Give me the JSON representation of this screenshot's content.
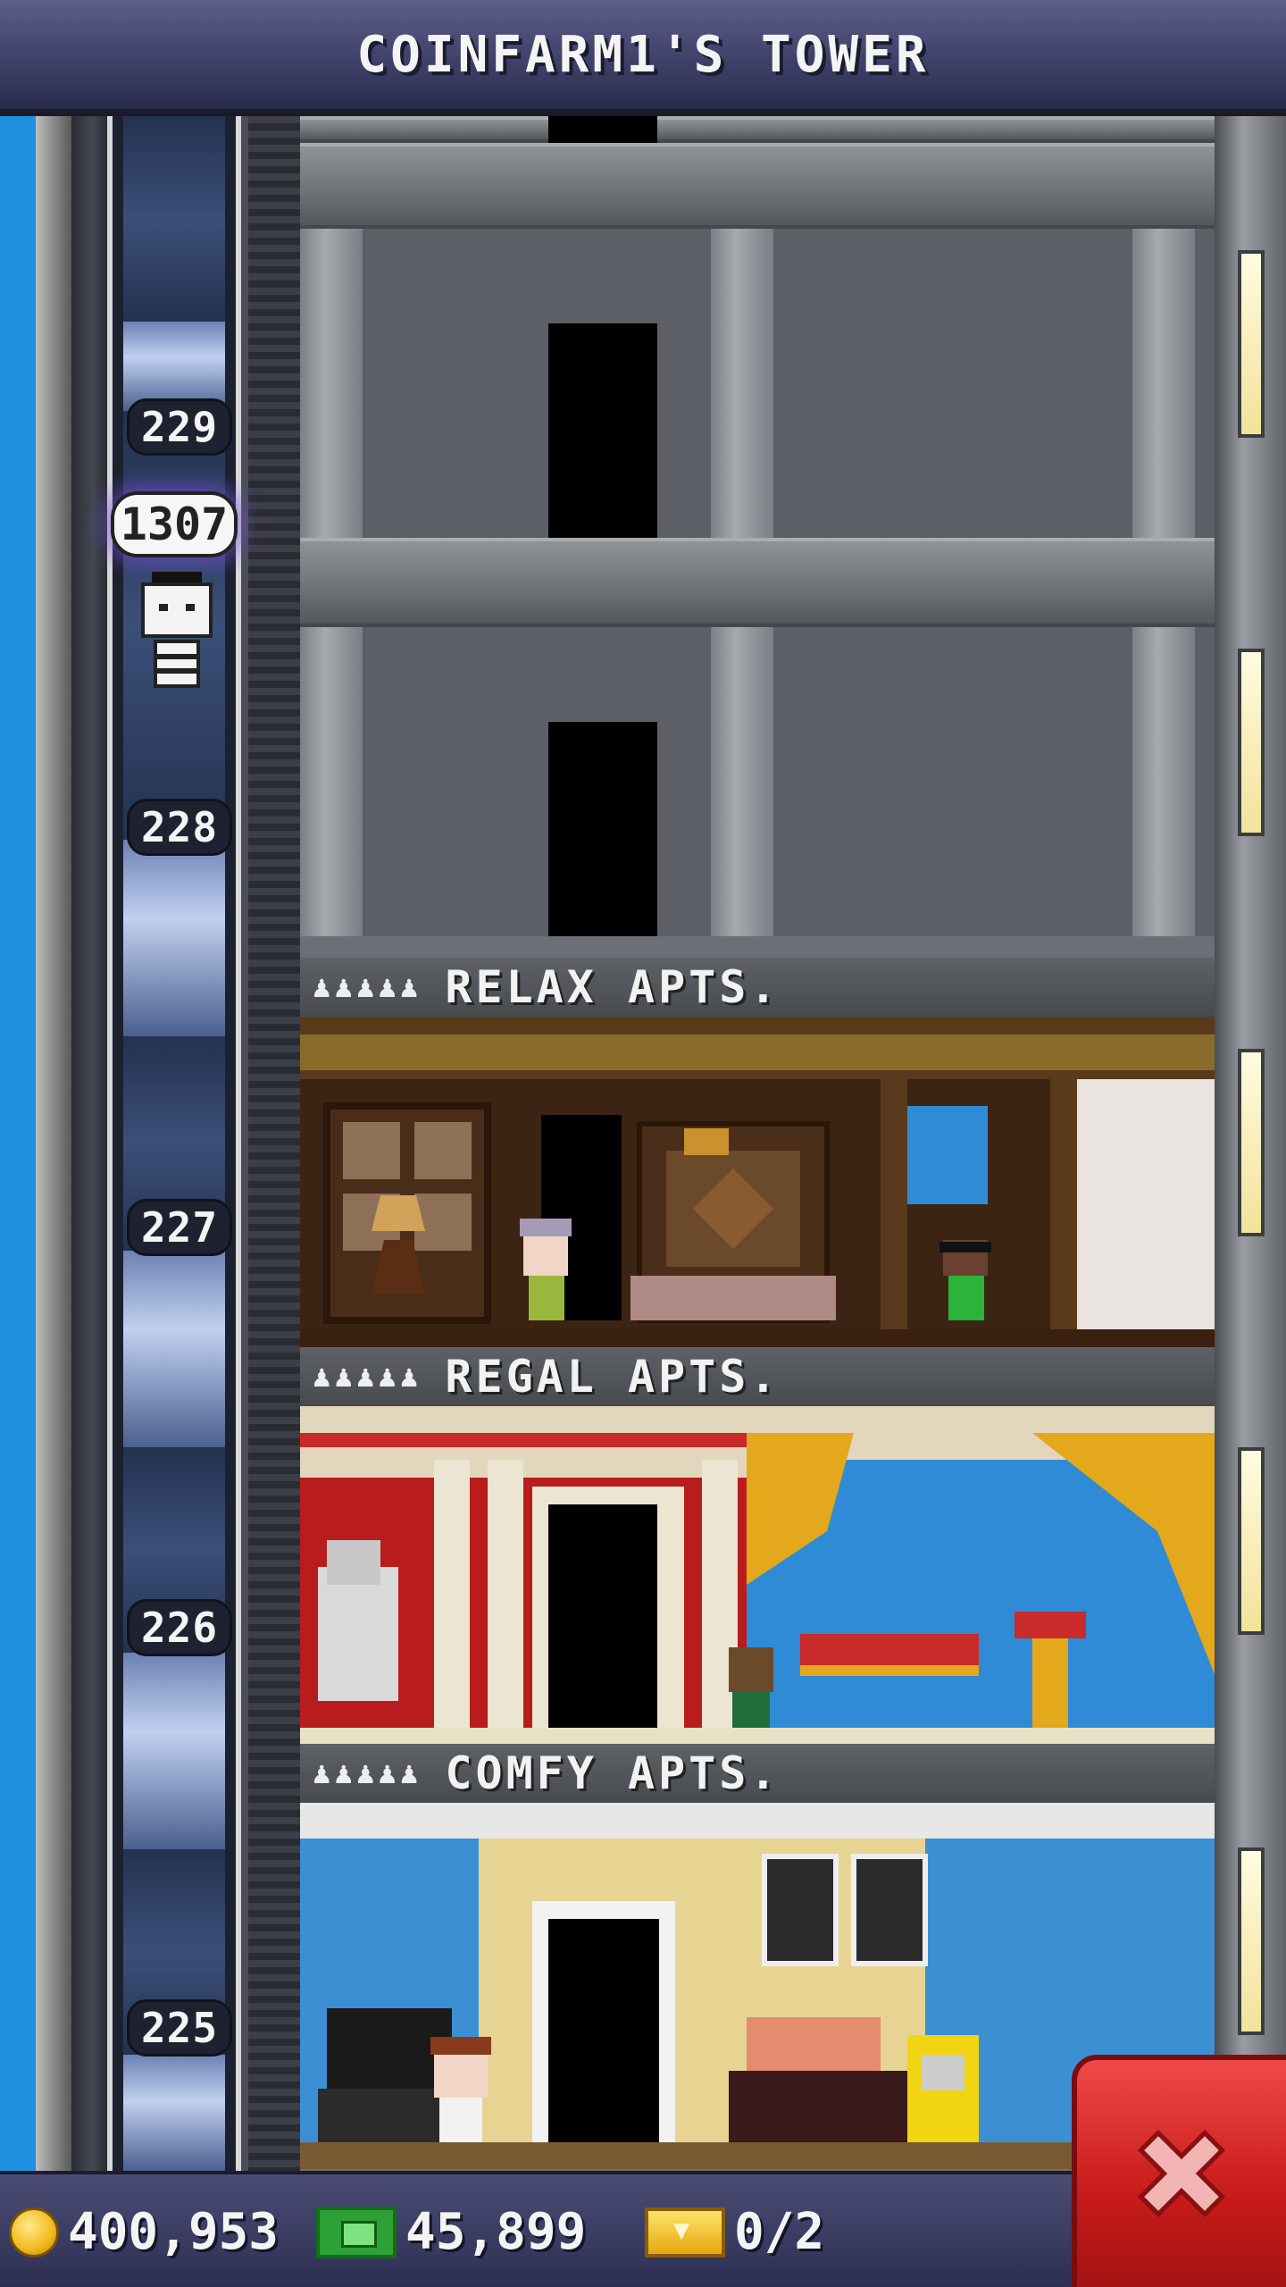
{
  "header": {
    "title": "COINFARM1'S TOWER"
  },
  "elevator": {
    "floors": [
      "229",
      "228",
      "227",
      "226",
      "225"
    ],
    "rider_bubble": "1307"
  },
  "floors": [
    {
      "id": "relax",
      "stars": "♟♟♟♟♟",
      "name": "RELAX APTS."
    },
    {
      "id": "regal",
      "stars": "♟♟♟♟♟",
      "name": "REGAL APTS."
    },
    {
      "id": "comfy",
      "stars": "♟♟♟♟♟",
      "name": "COMFY APTS."
    }
  ],
  "hud": {
    "coins": "400,953",
    "bux": "45,899",
    "tickets": "0/2"
  },
  "icons": {
    "coin": "coin-icon",
    "bux": "tower-bux-icon",
    "ticket": "vip-ticket-icon",
    "close": "close-x-icon"
  },
  "colors": {
    "header": "#3f416a",
    "close_button": "#c81b1b",
    "sky": "#1f8fe0"
  }
}
